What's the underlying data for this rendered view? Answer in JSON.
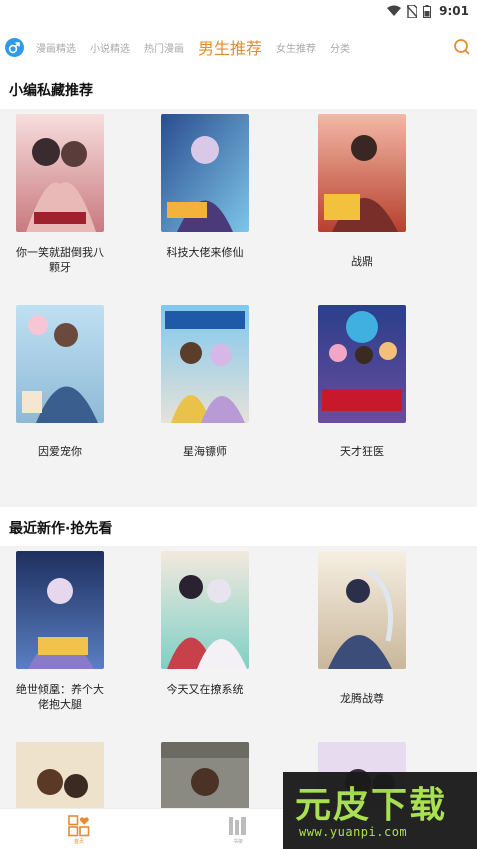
{
  "status_bar": {
    "time": "9:01"
  },
  "top_nav": {
    "tabs": [
      {
        "label": "漫画精选"
      },
      {
        "label": "小说精选"
      },
      {
        "label": "热门漫画"
      },
      {
        "label": "男生推荐"
      },
      {
        "label": "女生推荐"
      },
      {
        "label": "分类"
      }
    ],
    "active_tab_index": 3
  },
  "sections": [
    {
      "title": "小编私藏推荐",
      "items": [
        {
          "title": "你一笑就甜倒我八颗牙"
        },
        {
          "title": "科技大佬来修仙"
        },
        {
          "title": "战鼎"
        },
        {
          "title": "因爱宠你"
        },
        {
          "title": "星海镖师"
        },
        {
          "title": "天才狂医"
        }
      ]
    },
    {
      "title": "最近新作·抢先看",
      "items": [
        {
          "title": "绝世倾凰：养个大佬抱大腿"
        },
        {
          "title": "今天又在撩系统"
        },
        {
          "title": "龙腾战尊"
        },
        {
          "title": ""
        },
        {
          "title": ""
        },
        {
          "title": ""
        }
      ]
    }
  ],
  "bottom_nav": {
    "items": [
      {
        "label": "首页",
        "icon": "grid-heart-icon"
      },
      {
        "label": "书架",
        "icon": "bookshelf-icon"
      }
    ]
  },
  "watermark": {
    "title": "元皮下载",
    "url": "www.yuanpi.com"
  },
  "colors": {
    "accent": "#e68b2f",
    "blue": "#2f9ae6",
    "watermark_green": "#a6e04a"
  }
}
